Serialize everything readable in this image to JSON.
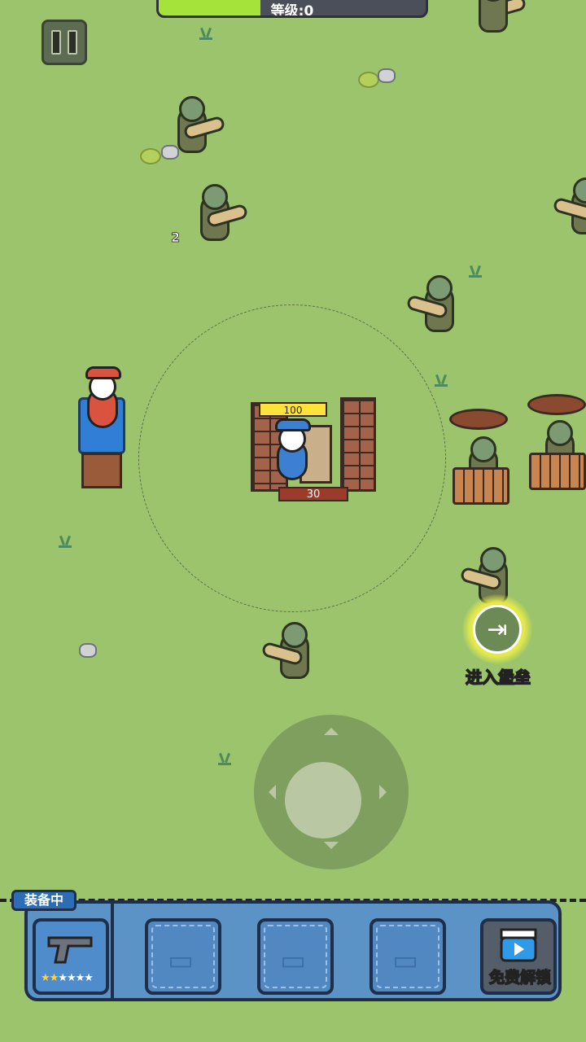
{
  "hud": {
    "level_label": "等级:0",
    "level_progress": 0.38,
    "pause_icon": "pause-icon"
  },
  "floating_text": {
    "damage": "2"
  },
  "fortress": {
    "hp": "100",
    "ammo": "30"
  },
  "actions": {
    "enter_fortress_label": "进入堡垒",
    "enter_icon": "exit-door-icon"
  },
  "weapon_bar": {
    "equipped_badge": "装备中",
    "equipped_weapon_icon": "pistol-icon",
    "equipped_star_count": 2,
    "equipped_star_total": 6,
    "locked_slot_icon": "revolver-silhouette-icon",
    "video_slot_icon": "video-clapper-icon",
    "video_slot_label": "免费解锁"
  },
  "colors": {
    "grass": "#9cc46c",
    "level_fill": "#a6e33a",
    "weapon_bar": "#5b93c6",
    "highlight": "#e3e84a"
  }
}
